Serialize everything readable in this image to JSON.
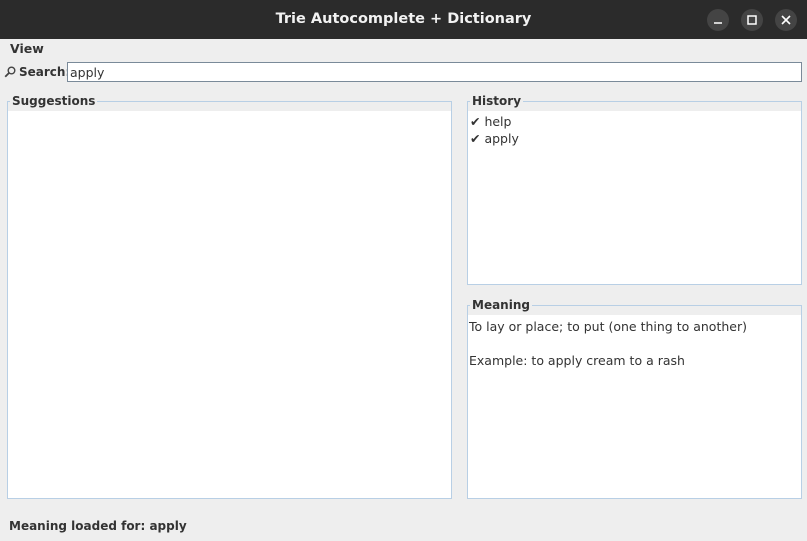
{
  "window": {
    "title": "Trie Autocomplete + Dictionary",
    "controls": [
      "minimize-icon",
      "maximize-icon",
      "close-icon"
    ]
  },
  "menubar": {
    "items": [
      {
        "label": "View"
      }
    ]
  },
  "search": {
    "label": "Search:",
    "value": "apply",
    "icon": "search-icon"
  },
  "suggestions": {
    "title": "Suggestions",
    "items": []
  },
  "history": {
    "title": "History",
    "items": [
      {
        "label": "✔ help"
      },
      {
        "label": "✔ apply"
      }
    ]
  },
  "meaning": {
    "title": "Meaning",
    "definition": "To lay or place; to put (one thing to another)",
    "example": "Example: to apply cream to a rash"
  },
  "status": {
    "text": "Meaning loaded for: apply"
  },
  "colors": {
    "titlebar": "#2b2b2b",
    "window_bg": "#eeeeee",
    "panel_border": "#b8cfe5",
    "text": "#333333"
  }
}
